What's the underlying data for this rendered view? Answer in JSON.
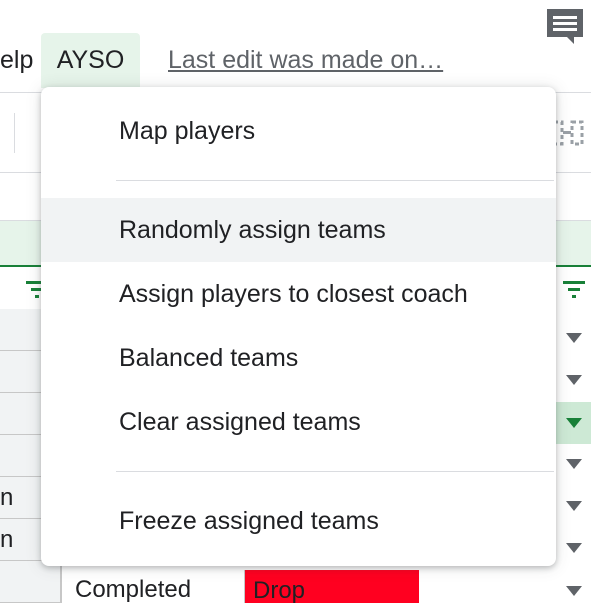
{
  "menubar": {
    "help_label": "elp",
    "ayso_label": "AYSO",
    "last_edit": "Last edit was made on…"
  },
  "grid": {
    "row_fragments": [
      "",
      "",
      "",
      "",
      "n",
      "n",
      ""
    ],
    "status_value": "Completed",
    "drop_value": "Drop"
  },
  "dropdown": {
    "items": [
      "Map players",
      "Randomly assign teams",
      "Assign players to closest coach",
      "Balanced teams",
      "Clear assigned teams",
      "Freeze assigned teams"
    ]
  },
  "colors": {
    "accent_green": "#188038",
    "header_green": "#e6f4ea",
    "drop_red": "#ff0020",
    "menu_hover": "#f1f3f4"
  },
  "icons": {
    "comment": "comment-icon",
    "filter": "filter-icon",
    "dropdown_arrow": "dropdown-arrow-icon",
    "toolbar": "column-layout-icon"
  }
}
